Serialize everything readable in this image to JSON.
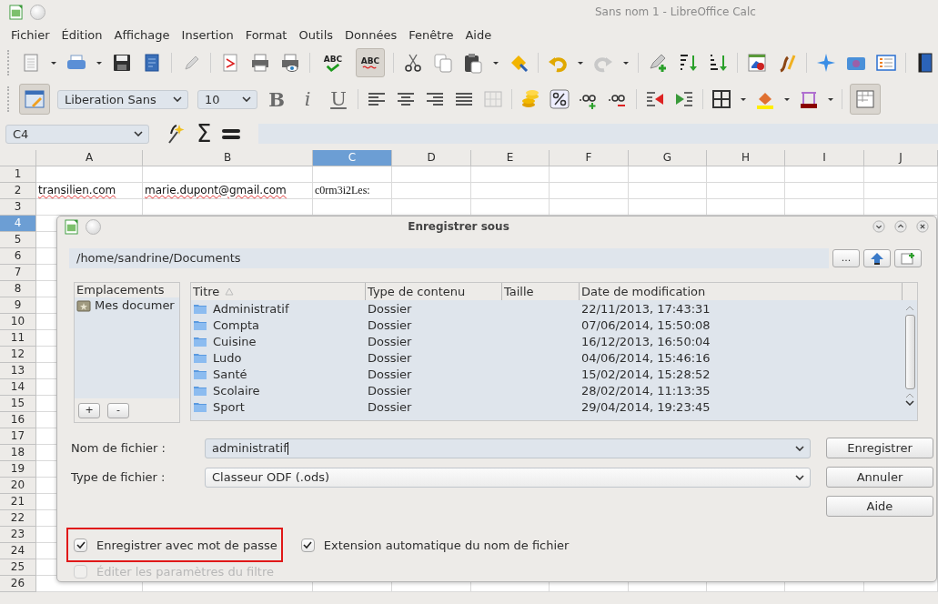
{
  "window": {
    "title": "Sans nom 1 - LibreOffice Calc"
  },
  "menu": [
    {
      "label": "Fichier"
    },
    {
      "label": "Édition"
    },
    {
      "label": "Affichage"
    },
    {
      "label": "Insertion"
    },
    {
      "label": "Format"
    },
    {
      "label": "Outils"
    },
    {
      "label": "Données"
    },
    {
      "label": "Fenêtre"
    },
    {
      "label": "Aide"
    }
  ],
  "standard_toolbar": {
    "spellcheck_label": "ABC",
    "autospell_label": "ABC",
    "autospell_pressed": true
  },
  "format_toolbar": {
    "sidebar_pressed": true,
    "font": "Liberation Sans",
    "size": "10",
    "style_buttons": [
      "B",
      "i",
      "U"
    ],
    "grid_pressed": true
  },
  "formula_bar": {
    "cell_ref": "C4",
    "sum_symbol": "Σ"
  },
  "sheet": {
    "columns": [
      {
        "label": "A",
        "selected": false
      },
      {
        "label": "B",
        "selected": false
      },
      {
        "label": "C",
        "selected": true
      },
      {
        "label": "D",
        "selected": false
      },
      {
        "label": "E",
        "selected": false
      },
      {
        "label": "F",
        "selected": false
      },
      {
        "label": "G",
        "selected": false
      },
      {
        "label": "H",
        "selected": false
      },
      {
        "label": "I",
        "selected": false
      },
      {
        "label": "J",
        "selected": false
      }
    ],
    "rows": [
      {
        "label": "1",
        "selected": false
      },
      {
        "label": "2",
        "selected": false,
        "cells": [
          {
            "text": "transilien.com",
            "misspelled": true
          },
          {
            "text": "marie.dupont@gmail.com",
            "misspelled": true
          },
          {
            "text": "c0rm3i2Les:",
            "misspelled": false
          }
        ]
      },
      {
        "label": "3",
        "selected": false
      },
      {
        "label": "4",
        "selected": true
      },
      {
        "label": "5",
        "selected": false
      },
      {
        "label": "6",
        "selected": false
      },
      {
        "label": "7",
        "selected": false
      },
      {
        "label": "8",
        "selected": false
      },
      {
        "label": "9",
        "selected": false
      },
      {
        "label": "10",
        "selected": false
      },
      {
        "label": "11",
        "selected": false
      },
      {
        "label": "12",
        "selected": false
      },
      {
        "label": "13",
        "selected": false
      },
      {
        "label": "14",
        "selected": false
      },
      {
        "label": "15",
        "selected": false
      },
      {
        "label": "16",
        "selected": false
      },
      {
        "label": "17",
        "selected": false
      },
      {
        "label": "18",
        "selected": false
      },
      {
        "label": "19",
        "selected": false
      },
      {
        "label": "20",
        "selected": false
      },
      {
        "label": "21",
        "selected": false
      },
      {
        "label": "22",
        "selected": false
      },
      {
        "label": "23",
        "selected": false
      },
      {
        "label": "24",
        "selected": false
      },
      {
        "label": "25",
        "selected": false
      },
      {
        "label": "26",
        "selected": false
      }
    ]
  },
  "dialog": {
    "title": "Enregistrer sous",
    "path": "/home/sandrine/Documents",
    "browse_label": "...",
    "places": {
      "header": "Emplacements",
      "items": [
        {
          "label": "Mes documer",
          "selected": false
        }
      ],
      "add_label": "+",
      "remove_label": "-"
    },
    "file_list": {
      "columns": [
        "Titre",
        "Type de contenu",
        "Taille",
        "Date de modification"
      ],
      "rows": [
        {
          "title": "Administratif",
          "type": "Dossier",
          "date": "22/11/2013, 17:43:31"
        },
        {
          "title": "Compta",
          "type": "Dossier",
          "date": "07/06/2014, 15:50:08"
        },
        {
          "title": "Cuisine",
          "type": "Dossier",
          "date": "16/12/2013, 16:50:04"
        },
        {
          "title": "Ludo",
          "type": "Dossier",
          "date": "04/06/2014, 15:46:16"
        },
        {
          "title": "Santé",
          "type": "Dossier",
          "date": "15/02/2014, 15:28:52"
        },
        {
          "title": "Scolaire",
          "type": "Dossier",
          "date": "28/02/2014, 11:13:35"
        },
        {
          "title": "Sport",
          "type": "Dossier",
          "date": "29/04/2014, 19:23:45"
        }
      ]
    },
    "filename": {
      "label": "Nom de fichier :",
      "value": "administratif"
    },
    "filetype": {
      "label": "Type de fichier :",
      "value": "Classeur ODF (.ods)"
    },
    "buttons": [
      "Enregistrer",
      "Annuler",
      "Aide"
    ],
    "options": [
      {
        "label": "Enregistrer avec mot de passe",
        "checked": true,
        "disabled": false,
        "highlighted": true
      },
      {
        "label": "Extension automatique du nom de fichier",
        "checked": true,
        "disabled": false,
        "highlighted": false
      },
      {
        "label": "Éditer les paramètres du filtre",
        "checked": false,
        "disabled": true,
        "highlighted": false
      }
    ]
  }
}
